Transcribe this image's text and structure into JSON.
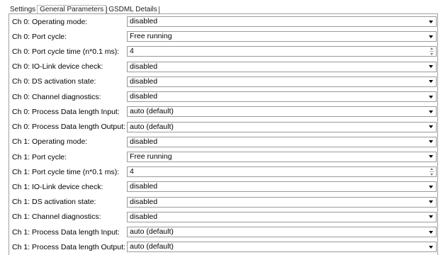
{
  "tabs": [
    {
      "label": "Settings"
    },
    {
      "label": "General Parameters"
    },
    {
      "label": "GSDML Details"
    }
  ],
  "rows": [
    {
      "label": "Ch 0: Operating mode:",
      "value": "disabled",
      "control": "dropdown"
    },
    {
      "label": "Ch 0: Port cycle:",
      "value": "Free running",
      "control": "dropdown"
    },
    {
      "label": "Ch 0: Port cycle time (n*0.1 ms):",
      "value": "4",
      "control": "spinner"
    },
    {
      "label": "Ch 0: IO-Link device check:",
      "value": "disabled",
      "control": "dropdown"
    },
    {
      "label": "Ch 0: DS activation state:",
      "value": "disabled",
      "control": "dropdown"
    },
    {
      "label": "Ch 0: Channel diagnostics:",
      "value": "disabled",
      "control": "dropdown"
    },
    {
      "label": "Ch 0: Process Data length Input:",
      "value": "auto (default)",
      "control": "dropdown"
    },
    {
      "label": "Ch 0: Process Data length Output:",
      "value": "auto (default)",
      "control": "dropdown"
    },
    {
      "label": "Ch 1: Operating mode:",
      "value": "disabled",
      "control": "dropdown"
    },
    {
      "label": "Ch 1: Port cycle:",
      "value": "Free running",
      "control": "dropdown"
    },
    {
      "label": "Ch 1: Port cycle time (n*0.1 ms):",
      "value": "4",
      "control": "spinner"
    },
    {
      "label": "Ch 1: IO-Link device check:",
      "value": "disabled",
      "control": "dropdown"
    },
    {
      "label": "Ch 1: DS activation state:",
      "value": "disabled",
      "control": "dropdown"
    },
    {
      "label": "Ch 1: Channel diagnostics:",
      "value": "disabled",
      "control": "dropdown"
    },
    {
      "label": "Ch 1: Process Data length Input:",
      "value": "auto (default)",
      "control": "dropdown"
    },
    {
      "label": "Ch 1: Process Data length Output:",
      "value": "auto (default)",
      "control": "dropdown"
    }
  ]
}
